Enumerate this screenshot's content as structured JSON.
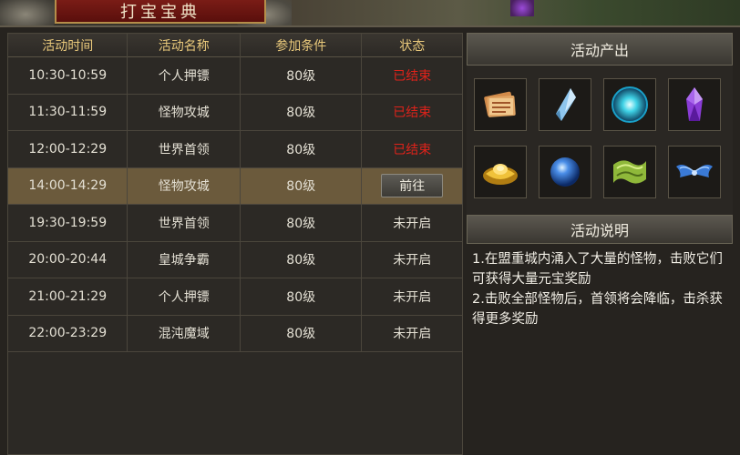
{
  "title": "打宝宝典",
  "table": {
    "headers": [
      "活动时间",
      "活动名称",
      "参加条件",
      "状态"
    ],
    "rows": [
      {
        "time": "10:30-10:59",
        "name": "个人押镖",
        "cond": "80级",
        "status": "已结束",
        "status_type": "ended"
      },
      {
        "time": "11:30-11:59",
        "name": "怪物攻城",
        "cond": "80级",
        "status": "已结束",
        "status_type": "ended"
      },
      {
        "time": "12:00-12:29",
        "name": "世界首领",
        "cond": "80级",
        "status": "已结束",
        "status_type": "ended"
      },
      {
        "time": "14:00-14:29",
        "name": "怪物攻城",
        "cond": "80级",
        "status": "前往",
        "status_type": "button"
      },
      {
        "time": "19:30-19:59",
        "name": "世界首领",
        "cond": "80级",
        "status": "未开启",
        "status_type": "normal"
      },
      {
        "time": "20:00-20:44",
        "name": "皇城争霸",
        "cond": "80级",
        "status": "未开启",
        "status_type": "normal"
      },
      {
        "time": "21:00-21:29",
        "name": "个人押镖",
        "cond": "80级",
        "status": "未开启",
        "status_type": "normal"
      },
      {
        "time": "22:00-23:29",
        "name": "混沌魔域",
        "cond": "80级",
        "status": "未开启",
        "status_type": "normal"
      }
    ]
  },
  "rewards": {
    "header": "活动产出",
    "items": [
      "scroll-icon",
      "crystal-icon",
      "orb-icon",
      "gem-icon",
      "ingot-icon",
      "sphere-icon",
      "map-icon",
      "wings-icon"
    ]
  },
  "description": {
    "header": "活动说明",
    "lines": [
      "1.在盟重城内涌入了大量的怪物，击败它们可获得大量元宝奖励",
      "2.击败全部怪物后，首领将会降临，击杀获得更多奖励"
    ]
  },
  "colors": {
    "header_text": "#e8c87a",
    "ended_status": "#e0221a",
    "highlight_row": "#6b5a3c",
    "title_plate": "#7a1c16"
  }
}
